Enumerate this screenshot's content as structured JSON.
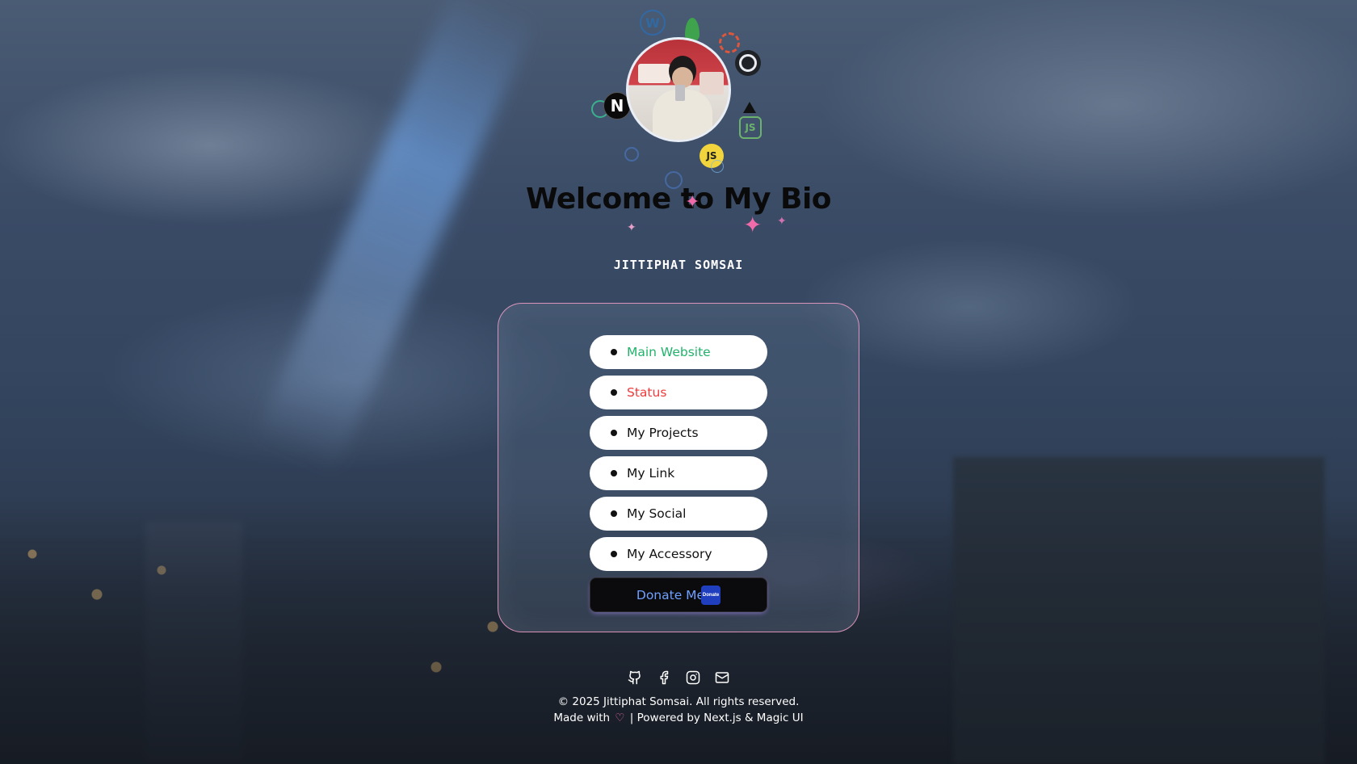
{
  "header": {
    "title": "Welcome to My Bio",
    "name": "JITTIPHAT SOMSAI"
  },
  "avatar": {
    "icons": [
      "wordpress-icon",
      "leaf-icon",
      "ubuntu-icon",
      "github-icon",
      "nextjs-icon",
      "vercel-icon",
      "nodejs-icon",
      "javascript-icon",
      "react-icon"
    ],
    "next_label": "N",
    "js_label": "JS",
    "node_label": "JS"
  },
  "links": [
    {
      "label": "Main Website",
      "color": "#21b36a"
    },
    {
      "label": "Status",
      "color": "#ef3b3b"
    },
    {
      "label": "My Projects",
      "color": "#111111"
    },
    {
      "label": "My Link",
      "color": "#111111"
    },
    {
      "label": "My Social",
      "color": "#111111"
    },
    {
      "label": "My Accessory",
      "color": "#111111"
    }
  ],
  "donate": {
    "label": "Donate Me",
    "badge": "Donate"
  },
  "social_icons": [
    "github-icon",
    "facebook-icon",
    "instagram-icon",
    "mail-icon"
  ],
  "footer": {
    "copyright": "© 2025 Jittiphat Somsai. All rights reserved.",
    "made_with": "Made with",
    "powered": "| Powered by Next.js & Magic UI"
  },
  "colors": {
    "accent_pink": "#f06ba9",
    "donate_blue": "#6fa0ff"
  }
}
